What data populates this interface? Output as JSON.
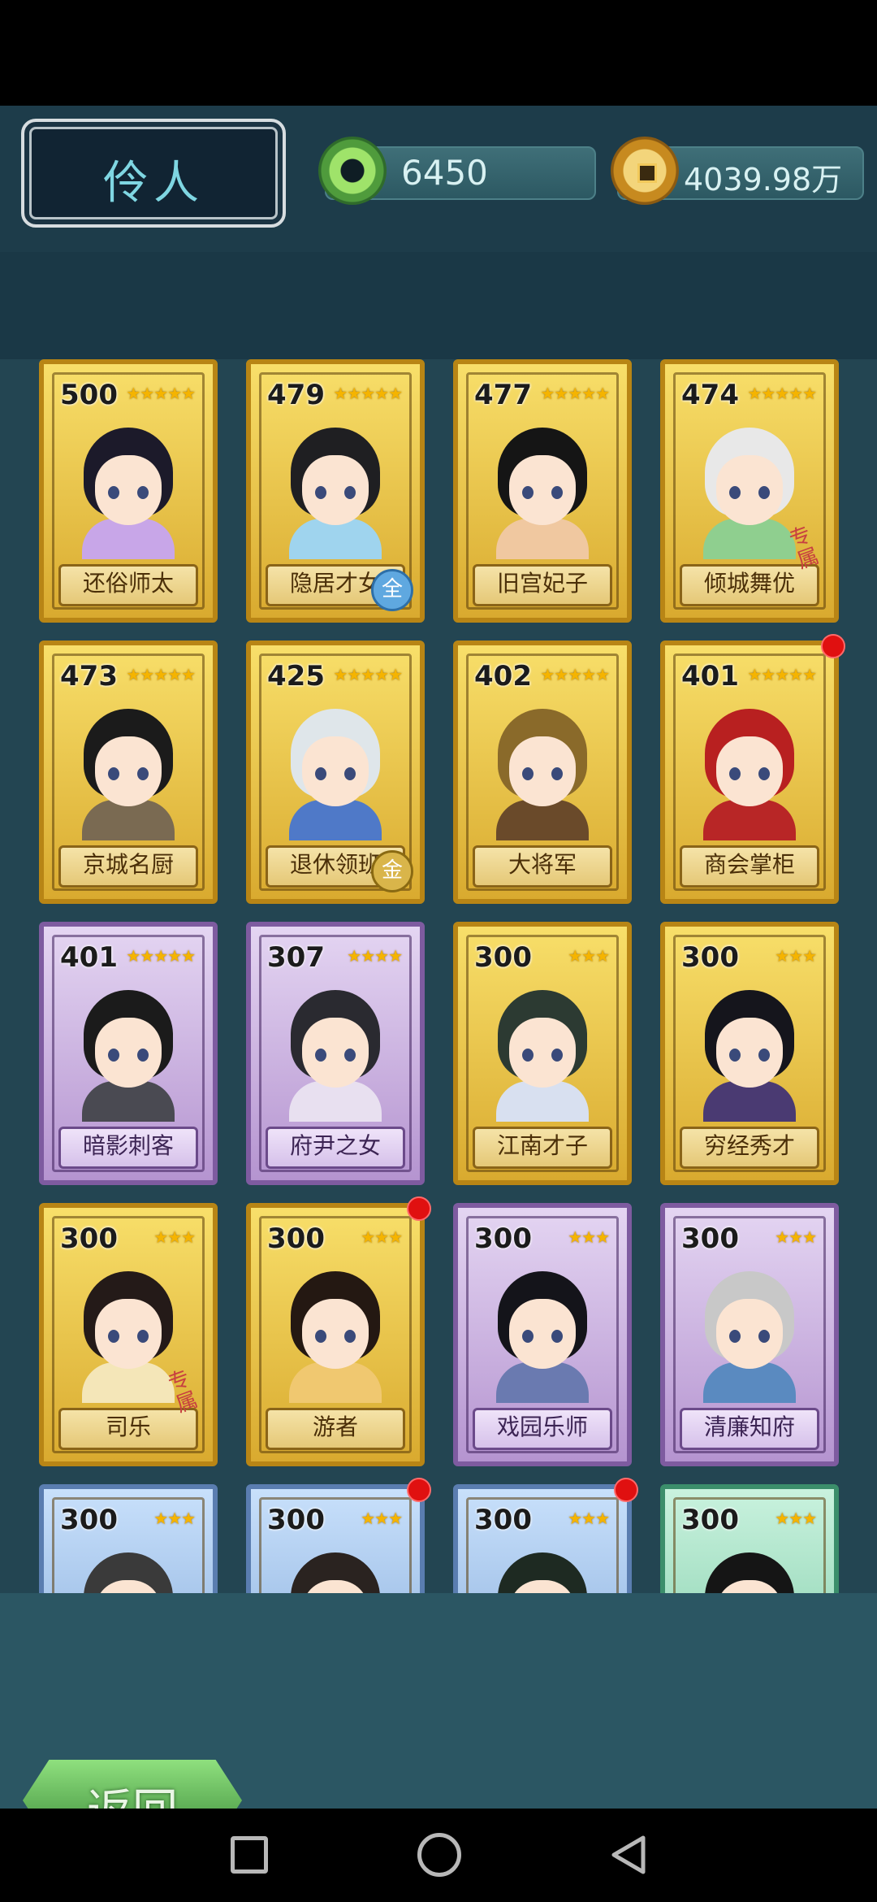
{
  "header": {
    "title": "伶人",
    "jade_amount": "6450",
    "coin_amount": "4039.98万"
  },
  "cards": [
    {
      "score": "500",
      "stars": "★★★★★",
      "name": "还俗师太",
      "frame": "gold",
      "hair": "#1c1a2a",
      "outfit": "#c8a6e8",
      "badge": "",
      "dot": false,
      "exclusive": false
    },
    {
      "score": "479",
      "stars": "★★★★★",
      "name": "隐居才女",
      "frame": "gold",
      "hair": "#1f1f22",
      "outfit": "#9fd4ee",
      "badge": "全",
      "dot": false,
      "exclusive": false
    },
    {
      "score": "477",
      "stars": "★★★★★",
      "name": "旧宫妃子",
      "frame": "gold",
      "hair": "#151515",
      "outfit": "#f0c8a0",
      "badge": "",
      "dot": false,
      "exclusive": false
    },
    {
      "score": "474",
      "stars": "★★★★★",
      "name": "倾城舞优",
      "frame": "gold",
      "hair": "#e8e8e8",
      "outfit": "#8fcf8f",
      "badge": "",
      "dot": false,
      "exclusive": true
    },
    {
      "score": "473",
      "stars": "★★★★★",
      "name": "京城名厨",
      "frame": "gold",
      "hair": "#1b1b1b",
      "outfit": "#7a6a52",
      "badge": "",
      "dot": false,
      "exclusive": false
    },
    {
      "score": "425",
      "stars": "★★★★★",
      "name": "退休领班",
      "frame": "gold",
      "hair": "#dfe6ea",
      "outfit": "#4f79c8",
      "badge": "金",
      "dot": false,
      "exclusive": false
    },
    {
      "score": "402",
      "stars": "★★★★★",
      "name": "大将军",
      "frame": "gold",
      "hair": "#8a6a2a",
      "outfit": "#6a4a2a",
      "badge": "",
      "dot": false,
      "exclusive": false
    },
    {
      "score": "401",
      "stars": "★★★★★",
      "name": "商会掌柜",
      "frame": "gold",
      "hair": "#b82020",
      "outfit": "#b82626",
      "badge": "",
      "dot": true,
      "exclusive": false
    },
    {
      "score": "401",
      "stars": "★★★★★",
      "name": "暗影刺客",
      "frame": "purple",
      "hair": "#1b1b1b",
      "outfit": "#4a4a52",
      "badge": "",
      "dot": false,
      "exclusive": false
    },
    {
      "score": "307",
      "stars": "★★★★",
      "name": "府尹之女",
      "frame": "purple",
      "hair": "#2a2a30",
      "outfit": "#e8e0f0",
      "badge": "",
      "dot": false,
      "exclusive": false
    },
    {
      "score": "300",
      "stars": "★★★",
      "name": "江南才子",
      "frame": "gold",
      "hair": "#2c3a32",
      "outfit": "#d8e0f0",
      "badge": "",
      "dot": false,
      "exclusive": false
    },
    {
      "score": "300",
      "stars": "★★★",
      "name": "穷经秀才",
      "frame": "gold",
      "hair": "#15151c",
      "outfit": "#4a3a72",
      "badge": "",
      "dot": false,
      "exclusive": false
    },
    {
      "score": "300",
      "stars": "★★★",
      "name": "司乐",
      "frame": "gold",
      "hair": "#241a18",
      "outfit": "#f4e6b8",
      "badge": "",
      "dot": false,
      "exclusive": true
    },
    {
      "score": "300",
      "stars": "★★★",
      "name": "游者",
      "frame": "gold",
      "hair": "#241812",
      "outfit": "#f0c870",
      "badge": "",
      "dot": true,
      "exclusive": false
    },
    {
      "score": "300",
      "stars": "★★★",
      "name": "戏园乐师",
      "frame": "purple",
      "hair": "#14141a",
      "outfit": "#6a7ab0",
      "badge": "",
      "dot": false,
      "exclusive": false
    },
    {
      "score": "300",
      "stars": "★★★",
      "name": "清廉知府",
      "frame": "purple",
      "hair": "#c8c8c8",
      "outfit": "#5a8ac0",
      "badge": "",
      "dot": false,
      "exclusive": false
    },
    {
      "score": "300",
      "stars": "★★★",
      "name": "",
      "frame": "blue",
      "hair": "#3a3a3a",
      "outfit": "#7fa6d7",
      "badge": "",
      "dot": false,
      "exclusive": false
    },
    {
      "score": "300",
      "stars": "★★★",
      "name": "",
      "frame": "blue",
      "hair": "#2a2320",
      "outfit": "#7fa6d7",
      "badge": "",
      "dot": true,
      "exclusive": false
    },
    {
      "score": "300",
      "stars": "★★★",
      "name": "",
      "frame": "blue",
      "hair": "#1e2a22",
      "outfit": "#7fa6d7",
      "badge": "",
      "dot": true,
      "exclusive": false
    },
    {
      "score": "300",
      "stars": "★★★",
      "name": "",
      "frame": "green",
      "hair": "#151515",
      "outfit": "#76c7a1",
      "badge": "",
      "dot": false,
      "exclusive": false
    }
  ],
  "exclusive_mark": "专属",
  "back_label": "返回",
  "icons": {
    "jade": "jade-disc-icon",
    "coin": "copper-coin-icon",
    "nav_home": "circle-home-icon",
    "nav_recent": "square-recents-icon",
    "nav_back": "triangle-back-icon"
  },
  "colors": {
    "background": "#1d3c4a",
    "title_text": "#7fd6e2",
    "dot": "#e01010"
  }
}
